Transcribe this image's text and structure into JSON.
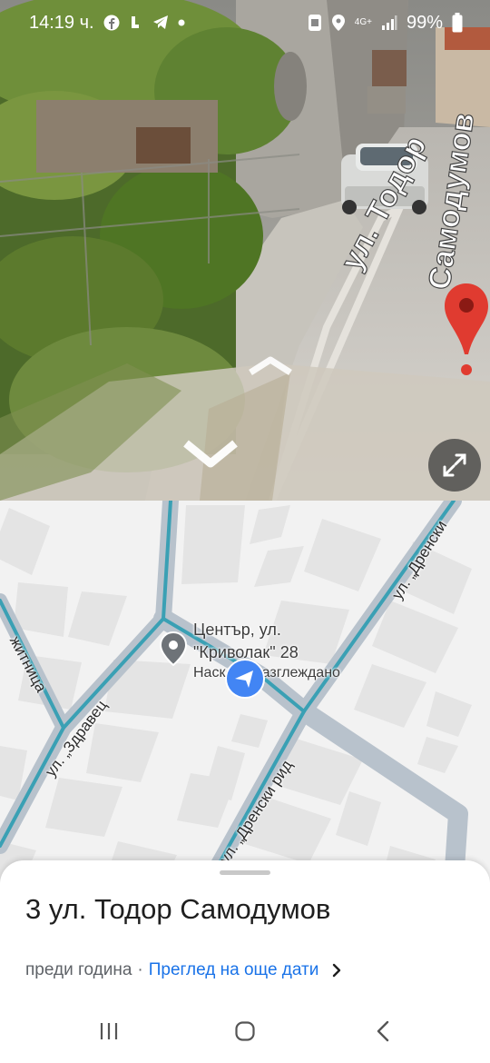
{
  "status_bar": {
    "time": "14:19 ч.",
    "network": "4G+",
    "battery": "99%"
  },
  "street_view": {
    "street_sign_1": "ул. Тодор",
    "street_sign_2": "Самодумов",
    "icons": [
      "expand-icon",
      "location-pin-icon",
      "nav-arrow-up-icon",
      "nav-arrow-down-icon"
    ]
  },
  "map": {
    "place_label_line1": "Център, ул.",
    "place_label_line2": "\"Криволак\" 28",
    "viewed_label": "Наскоро разглеждано",
    "streets": {
      "zdravets": "ул. „Здравец",
      "drenski_rid": "ул. „Дренски рид",
      "drenski_top": "ул. „Дренски",
      "left_street": "житница"
    },
    "colors": {
      "road_fill": "#b8c2cc",
      "route": "#3aa0b4",
      "arrow": "#4285f4"
    }
  },
  "sheet": {
    "title": "3 ул. Тодор Самодумов",
    "date": "преди година",
    "separator": "·",
    "more_dates_link": "Преглед на още дати"
  }
}
